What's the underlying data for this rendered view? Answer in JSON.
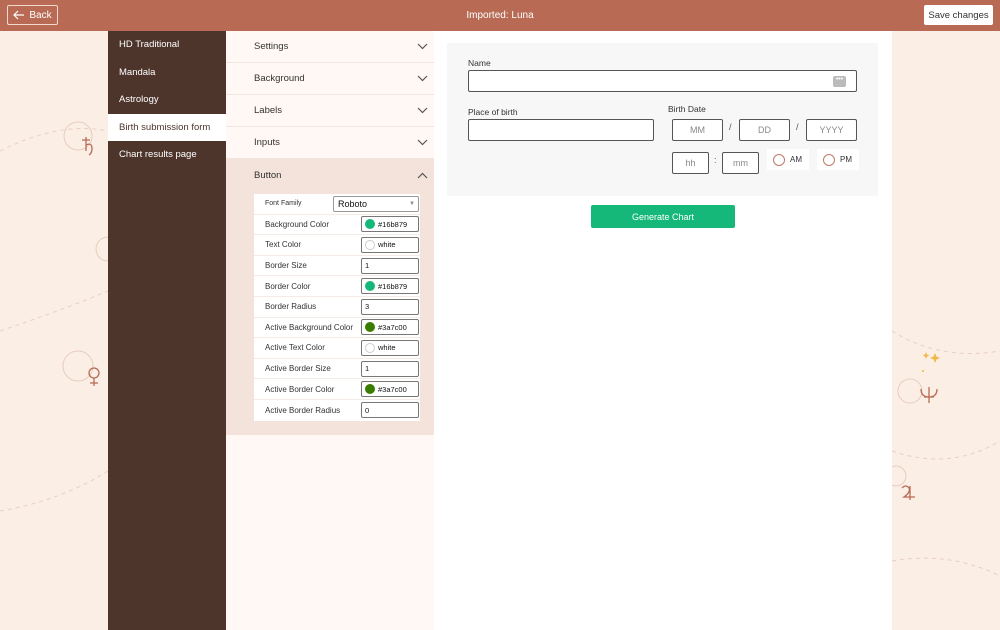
{
  "topbar": {
    "back_label": "Back",
    "title": "Imported: Luna",
    "save_label": "Save changes"
  },
  "nav": {
    "items": [
      {
        "label": "HD Traditional"
      },
      {
        "label": "Mandala"
      },
      {
        "label": "Astrology"
      },
      {
        "label": "Birth submission form"
      },
      {
        "label": "Chart results page"
      }
    ],
    "active_index": 3
  },
  "accordion": {
    "sections": [
      {
        "label": "Settings",
        "open": false
      },
      {
        "label": "Background",
        "open": false
      },
      {
        "label": "Labels",
        "open": false
      },
      {
        "label": "Inputs",
        "open": false
      },
      {
        "label": "Button",
        "open": true
      }
    ]
  },
  "button_props": {
    "font_family_label": "Font Family",
    "font_family_value": "Roboto",
    "rows": [
      {
        "label": "Background Color",
        "value": "#16b879",
        "swatch": "#16b879"
      },
      {
        "label": "Text Color",
        "value": "white",
        "swatch": "#ffffff"
      },
      {
        "label": "Border Size",
        "value": "1"
      },
      {
        "label": "Border Color",
        "value": "#16b879",
        "swatch": "#16b879"
      },
      {
        "label": "Border Radius",
        "value": "3"
      },
      {
        "label": "Active Background Color",
        "value": "#3a7c00",
        "swatch": "#3a7c00"
      },
      {
        "label": "Active Text Color",
        "value": "white",
        "swatch": "#ffffff"
      },
      {
        "label": "Active Border Size",
        "value": "1"
      },
      {
        "label": "Active Border Color",
        "value": "#3a7c00",
        "swatch": "#3a7c00"
      },
      {
        "label": "Active Border Radius",
        "value": "0"
      }
    ]
  },
  "preview": {
    "name_label": "Name",
    "place_label": "Place of birth",
    "birth_date_label": "Birth Date",
    "month_placeholder": "MM",
    "day_placeholder": "DD",
    "year_placeholder": "YYYY",
    "date_sep": "/",
    "hour_placeholder": "hh",
    "minute_placeholder": "mm",
    "time_sep": ":",
    "am_label": "AM",
    "pm_label": "PM",
    "generate_label": "Generate Chart"
  },
  "colors": {
    "topbar": "#b86a55",
    "nav_bg": "#4e352c",
    "accent_green": "#16b879",
    "page_bg": "#fbeee5"
  }
}
